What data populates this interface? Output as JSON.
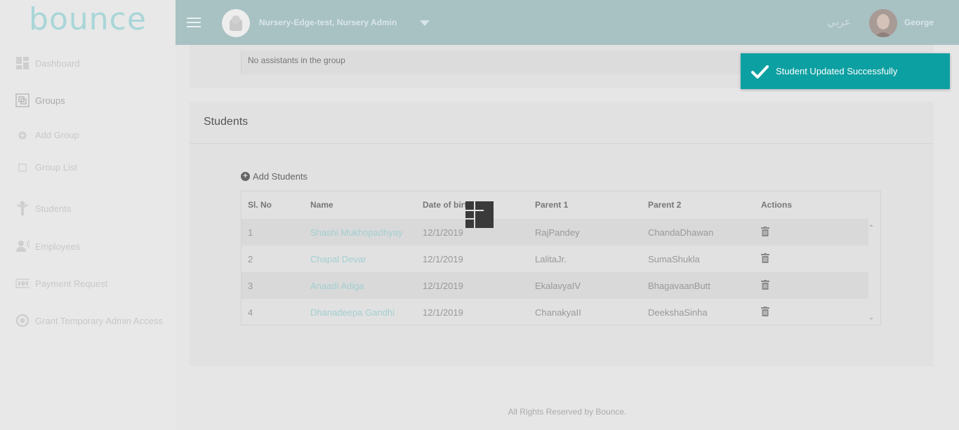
{
  "brand": {
    "logo": "bounce"
  },
  "sidebar": {
    "items": [
      {
        "label": "Dashboard",
        "icon": "dashboard-icon"
      },
      {
        "label": "Groups",
        "icon": "groups-icon"
      },
      {
        "label": "Add Group",
        "icon": "plus-circle-icon"
      },
      {
        "label": "Group List",
        "icon": "square-icon"
      },
      {
        "label": "Students",
        "icon": "student-icon"
      },
      {
        "label": "Employees",
        "icon": "employees-icon"
      },
      {
        "label": "Payment Request",
        "icon": "money-icon"
      },
      {
        "label": "Grant Temporary Admin Access",
        "icon": "admin-access-icon"
      }
    ]
  },
  "header": {
    "org_title": "Nursery-Edge-test, Nursery Admin",
    "language": "عربي",
    "user_name": "George"
  },
  "assistants": {
    "empty_text": "No assistants in the group"
  },
  "students": {
    "heading": "Students",
    "add_label": "Add Students",
    "columns": [
      "Sl. No",
      "Name",
      "Date of birth",
      "Parent 1",
      "Parent 2",
      "Actions"
    ],
    "rows": [
      {
        "sl": "1",
        "name": "Shashi Mukhopadhyay",
        "dob": "12/1/2019",
        "parent1": "RajPandey",
        "parent2": "ChandaDhawan"
      },
      {
        "sl": "2",
        "name": "Chapal Devar",
        "dob": "12/1/2019",
        "parent1": "LalitaJr.",
        "parent2": "SumaShukla"
      },
      {
        "sl": "3",
        "name": "Anaadi Adiga",
        "dob": "12/1/2019",
        "parent1": "EkalavyaIV",
        "parent2": "BhagavaanButt"
      },
      {
        "sl": "4",
        "name": "Dhanadeepa Gandhi",
        "dob": "12/1/2019",
        "parent1": "ChanakyaII",
        "parent2": "DeekshaSinha"
      }
    ]
  },
  "toast": {
    "message": "Student Updated Successfully",
    "color": "#0da0a2"
  },
  "footer": {
    "text": "All Rights Reserved by Bounce."
  },
  "colors": {
    "header_bg": "#a8c1c3",
    "link": "#a3cfd1"
  }
}
